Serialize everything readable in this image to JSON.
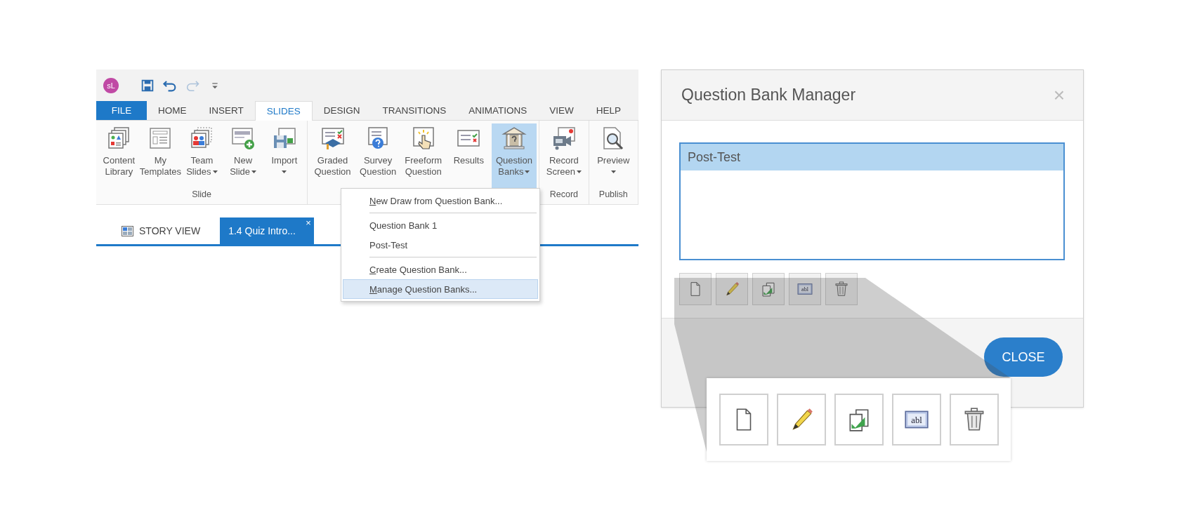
{
  "app": {
    "logo": "sL",
    "quick_access": [
      {
        "kind": "save",
        "disabled": false
      },
      {
        "kind": "undo",
        "disabled": false
      },
      {
        "kind": "redo",
        "disabled": true
      },
      {
        "kind": "customize",
        "disabled": false
      }
    ],
    "tabs": [
      {
        "label": "FILE",
        "kind": "file",
        "selected": false
      },
      {
        "label": "HOME",
        "kind": "tab",
        "selected": false
      },
      {
        "label": "INSERT",
        "kind": "tab",
        "selected": false
      },
      {
        "label": "SLIDES",
        "kind": "tab",
        "selected": true
      },
      {
        "label": "DESIGN",
        "kind": "tab",
        "selected": false
      },
      {
        "label": "TRANSITIONS",
        "kind": "tab",
        "selected": false
      },
      {
        "label": "ANIMATIONS",
        "kind": "tab",
        "selected": false
      },
      {
        "label": "VIEW",
        "kind": "tab",
        "selected": false
      },
      {
        "label": "HELP",
        "kind": "tab",
        "selected": false
      }
    ],
    "ribbon_groups": [
      {
        "label": "Slide",
        "buttons": [
          {
            "kind": "content-library",
            "lines": [
              "Content",
              "Library"
            ],
            "dropdown": false,
            "pressed": false
          },
          {
            "kind": "templates",
            "lines": [
              "My",
              "Templates"
            ],
            "dropdown": false,
            "pressed": false
          },
          {
            "kind": "team-slides",
            "lines": [
              "Team",
              "Slides"
            ],
            "dropdown": true,
            "pressed": false
          },
          {
            "kind": "new-slide",
            "lines": [
              "New",
              "Slide"
            ],
            "dropdown": true,
            "pressed": false
          },
          {
            "kind": "import",
            "lines": [
              "Import"
            ],
            "dropdown": true,
            "pressed": false
          }
        ]
      },
      {
        "buttons": [
          {
            "kind": "graded",
            "lines": [
              "Graded",
              "Question"
            ],
            "dropdown": false,
            "pressed": false
          },
          {
            "kind": "survey",
            "lines": [
              "Survey",
              "Question"
            ],
            "dropdown": false,
            "pressed": false
          },
          {
            "kind": "freeform",
            "lines": [
              "Freeform",
              "Question"
            ],
            "dropdown": false,
            "pressed": false
          },
          {
            "kind": "results",
            "lines": [
              "Results"
            ],
            "dropdown": false,
            "pressed": false
          },
          {
            "kind": "question-banks",
            "lines": [
              "Question",
              "Banks"
            ],
            "dropdown": true,
            "pressed": true
          }
        ]
      },
      {
        "label": "Record",
        "buttons": [
          {
            "kind": "record-screen",
            "lines": [
              "Record",
              "Screen"
            ],
            "dropdown": true,
            "pressed": false
          }
        ]
      },
      {
        "label": "Publish",
        "buttons": [
          {
            "kind": "preview",
            "lines": [
              "Preview"
            ],
            "dropdown": true,
            "pressed": false
          }
        ]
      }
    ],
    "doc_tabs": [
      {
        "label": "STORY VIEW",
        "kind": "story",
        "selected": false
      },
      {
        "label": "1.4 Quiz Intro...",
        "kind": "slide",
        "selected": true,
        "close": "×"
      }
    ],
    "menu": [
      {
        "kind": "item",
        "label": "New Draw from Question Bank...",
        "mnemonic": true,
        "selected": false
      },
      {
        "kind": "separator"
      },
      {
        "kind": "item",
        "label": "Question Bank 1",
        "mnemonic": false,
        "selected": false
      },
      {
        "kind": "item",
        "label": "Post-Test",
        "mnemonic": false,
        "selected": false
      },
      {
        "kind": "separator"
      },
      {
        "kind": "item",
        "label": "Create Question Bank...",
        "mnemonic": true,
        "selected": false
      },
      {
        "kind": "item",
        "label": "Manage Question Banks...",
        "mnemonic": true,
        "selected": true
      }
    ]
  },
  "dialog": {
    "title": "Question Bank Manager",
    "close": "×",
    "list": [
      {
        "label": "Post-Test",
        "selected": true
      }
    ],
    "toolbar": [
      {
        "kind": "new"
      },
      {
        "kind": "edit"
      },
      {
        "kind": "copy"
      },
      {
        "kind": "rename",
        "text": "abl"
      },
      {
        "kind": "delete"
      }
    ],
    "button": "CLOSE",
    "callout": {
      "toolbar": [
        {
          "kind": "new"
        },
        {
          "kind": "edit"
        },
        {
          "kind": "copy"
        },
        {
          "kind": "rename",
          "text": "abl"
        },
        {
          "kind": "delete"
        }
      ]
    }
  }
}
